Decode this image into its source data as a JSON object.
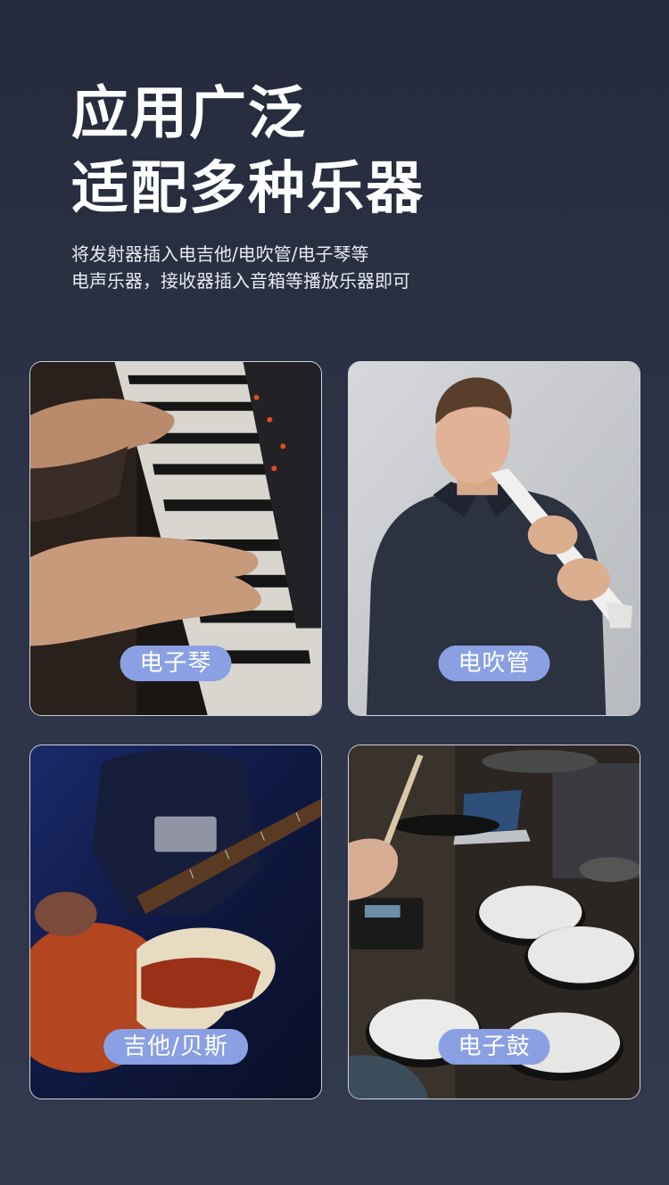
{
  "headline": {
    "line1": "应用广泛",
    "line2": "适配多种乐器"
  },
  "subtitle": {
    "line1": "将发射器插入电吉他/电吹管/电子琴等",
    "line2": "电声乐器，接收器插入音箱等播放乐器即可"
  },
  "instruments": [
    {
      "label": "电子琴"
    },
    {
      "label": "电吹管"
    },
    {
      "label": "吉他/贝斯"
    },
    {
      "label": "电子鼓"
    }
  ]
}
